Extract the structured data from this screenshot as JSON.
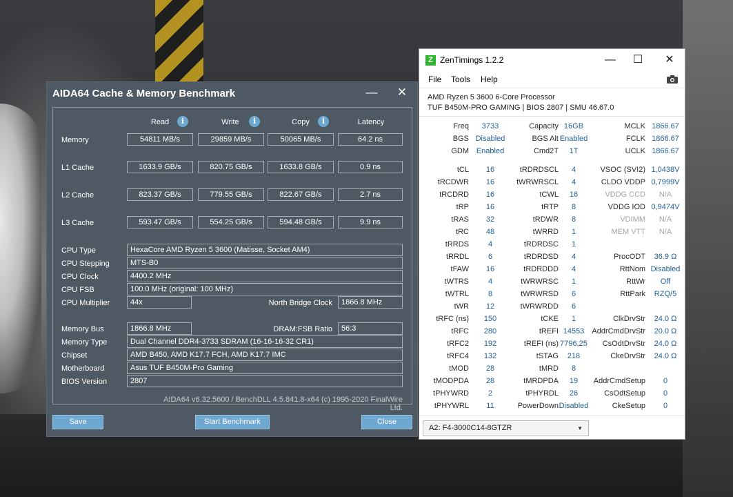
{
  "aida": {
    "title": "AIDA64 Cache & Memory Benchmark",
    "columns": [
      "Read",
      "Write",
      "Copy",
      "Latency"
    ],
    "bench_rows": [
      {
        "label": "Memory",
        "values": [
          "54811 MB/s",
          "29859 MB/s",
          "50065 MB/s",
          "64.2 ns"
        ]
      },
      {
        "label": "L1 Cache",
        "values": [
          "1633.9 GB/s",
          "820.75 GB/s",
          "1633.8 GB/s",
          "0.9 ns"
        ]
      },
      {
        "label": "L2 Cache",
        "values": [
          "823.37 GB/s",
          "779.55 GB/s",
          "822.67 GB/s",
          "2.7 ns"
        ]
      },
      {
        "label": "L3 Cache",
        "values": [
          "593.47 GB/s",
          "554.25 GB/s",
          "594.48 GB/s",
          "9.9 ns"
        ]
      }
    ],
    "cpu_type_label": "CPU Type",
    "cpu_type": "HexaCore AMD Ryzen 5 3600  (Matisse, Socket AM4)",
    "cpu_stepping_label": "CPU Stepping",
    "cpu_stepping": "MTS-B0",
    "cpu_clock_label": "CPU Clock",
    "cpu_clock": "4400.2 MHz",
    "cpu_fsb_label": "CPU FSB",
    "cpu_fsb": "100.0 MHz  (original: 100 MHz)",
    "cpu_multiplier_label": "CPU Multiplier",
    "cpu_multiplier": "44x",
    "nb_clock_label": "North Bridge Clock",
    "nb_clock": "1866.8 MHz",
    "memory_bus_label": "Memory Bus",
    "memory_bus": "1866.8 MHz",
    "dram_fsb_label": "DRAM:FSB Ratio",
    "dram_fsb": "56:3",
    "memory_type_label": "Memory Type",
    "memory_type": "Dual Channel DDR4-3733 SDRAM  (16-16-16-32 CR1)",
    "chipset_label": "Chipset",
    "chipset": "AMD B450, AMD K17.7 FCH, AMD K17.7 IMC",
    "motherboard_label": "Motherboard",
    "motherboard": "Asus TUF B450M-Pro Gaming",
    "bios_label": "BIOS Version",
    "bios": "2807",
    "footer": "AIDA64 v6.32.5600 / BenchDLL 4.5.841.8-x64  (c) 1995-2020 FinalWire Ltd.",
    "save_label": "Save",
    "start_label": "Start Benchmark",
    "close_label": "Close"
  },
  "zen": {
    "title": "ZenTimings 1.2.2",
    "logo": "Z",
    "menu": [
      "File",
      "Tools",
      "Help"
    ],
    "cpu_line": "AMD Ryzen 5 3600 6-Core Processor",
    "board_line": "TUF B450M-PRO GAMING | BIOS 2807 | SMU 46.67.0",
    "top": [
      [
        "Freq",
        "3733",
        "Capacity",
        "16GB",
        "MCLK",
        "1866.67"
      ],
      [
        "BGS",
        "Disabled",
        "BGS Alt",
        "Enabled",
        "FCLK",
        "1866.67"
      ],
      [
        "GDM",
        "Enabled",
        "Cmd2T",
        "1T",
        "UCLK",
        "1866.67"
      ]
    ],
    "timings": [
      [
        "tCL",
        "16",
        "tRDRDSCL",
        "4",
        "VSOC (SVI2)",
        "1,0438V"
      ],
      [
        "tRCDWR",
        "16",
        "tWRWRSCL",
        "4",
        "CLDO VDDP",
        "0,7999V"
      ],
      [
        "tRCDRD",
        "16",
        "tCWL",
        "16",
        "VDDG CCD",
        "N/A"
      ],
      [
        "tRP",
        "16",
        "tRTP",
        "8",
        "VDDG IOD",
        "0,9474V"
      ],
      [
        "tRAS",
        "32",
        "tRDWR",
        "8",
        "VDIMM",
        "N/A"
      ],
      [
        "tRC",
        "48",
        "tWRRD",
        "1",
        "MEM VTT",
        "N/A"
      ],
      [
        "tRRDS",
        "4",
        "tRDRDSC",
        "1",
        "",
        ""
      ],
      [
        "tRRDL",
        "6",
        "tRDRDSD",
        "4",
        "ProcODT",
        "36.9 Ω"
      ],
      [
        "tFAW",
        "16",
        "tRDRDDD",
        "4",
        "RttNom",
        "Disabled"
      ],
      [
        "tWTRS",
        "4",
        "tWRWRSC",
        "1",
        "RttWr",
        "Off"
      ],
      [
        "tWTRL",
        "8",
        "tWRWRSD",
        "6",
        "RttPark",
        "RZQ/5"
      ],
      [
        "tWR",
        "12",
        "tWRWRDD",
        "6",
        "",
        ""
      ],
      [
        "tRFC (ns)",
        "150",
        "tCKE",
        "1",
        "ClkDrvStr",
        "24.0 Ω"
      ],
      [
        "tRFC",
        "280",
        "tREFI",
        "14553",
        "AddrCmdDrvStr",
        "20.0 Ω"
      ],
      [
        "tRFC2",
        "192",
        "tREFI (ns)",
        "7796,25",
        "CsOdtDrvStr",
        "24.0 Ω"
      ],
      [
        "tRFC4",
        "132",
        "tSTAG",
        "218",
        "CkeDrvStr",
        "24.0 Ω"
      ],
      [
        "tMOD",
        "28",
        "tMRD",
        "8",
        "",
        ""
      ],
      [
        "tMODPDA",
        "28",
        "tMRDPDA",
        "19",
        "AddrCmdSetup",
        "0"
      ],
      [
        "tPHYWRD",
        "2",
        "tPHYRDL",
        "26",
        "CsOdtSetup",
        "0"
      ],
      [
        "tPHYWRL",
        "11",
        "PowerDown",
        "Disabled",
        "CkeSetup",
        "0"
      ]
    ],
    "dim_labels": [
      "VDDG CCD",
      "VDIMM",
      "MEM VTT"
    ],
    "profile": "A2: F4-3000C14-8GTZR",
    "colors": {
      "value": "#1f5e96",
      "dim": "#a3a3a3",
      "aida_bg": "#4f5964",
      "aida_button": "#6ea7d0"
    }
  }
}
